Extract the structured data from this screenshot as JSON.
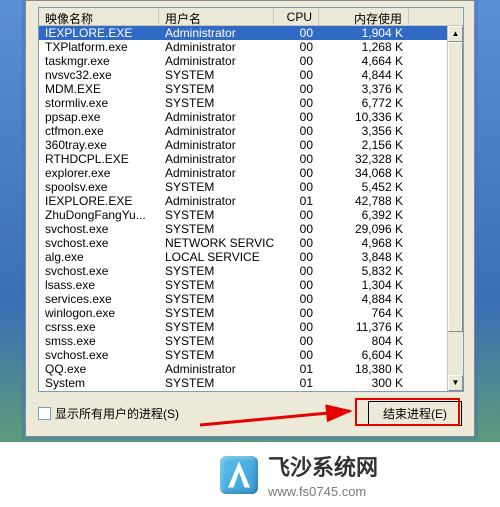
{
  "columns": {
    "image": "映像名称",
    "user": "用户名",
    "cpu": "CPU",
    "memory": "内存使用"
  },
  "rows": [
    {
      "img": "IEXPLORE.EXE",
      "user": "Administrator",
      "cpu": "00",
      "mem": "1,904 K",
      "sel": true
    },
    {
      "img": "TXPlatform.exe",
      "user": "Administrator",
      "cpu": "00",
      "mem": "1,268 K"
    },
    {
      "img": "taskmgr.exe",
      "user": "Administrator",
      "cpu": "00",
      "mem": "4,664 K"
    },
    {
      "img": "nvsvc32.exe",
      "user": "SYSTEM",
      "cpu": "00",
      "mem": "4,844 K"
    },
    {
      "img": "MDM.EXE",
      "user": "SYSTEM",
      "cpu": "00",
      "mem": "3,376 K"
    },
    {
      "img": "stormliv.exe",
      "user": "SYSTEM",
      "cpu": "00",
      "mem": "6,772 K"
    },
    {
      "img": "ppsap.exe",
      "user": "Administrator",
      "cpu": "00",
      "mem": "10,336 K"
    },
    {
      "img": "ctfmon.exe",
      "user": "Administrator",
      "cpu": "00",
      "mem": "3,356 K"
    },
    {
      "img": "360tray.exe",
      "user": "Administrator",
      "cpu": "00",
      "mem": "2,156 K"
    },
    {
      "img": "RTHDCPL.EXE",
      "user": "Administrator",
      "cpu": "00",
      "mem": "32,328 K"
    },
    {
      "img": "explorer.exe",
      "user": "Administrator",
      "cpu": "00",
      "mem": "34,068 K"
    },
    {
      "img": "spoolsv.exe",
      "user": "SYSTEM",
      "cpu": "00",
      "mem": "5,452 K"
    },
    {
      "img": "IEXPLORE.EXE",
      "user": "Administrator",
      "cpu": "01",
      "mem": "42,788 K"
    },
    {
      "img": "ZhuDongFangYu...",
      "user": "SYSTEM",
      "cpu": "00",
      "mem": "6,392 K"
    },
    {
      "img": "svchost.exe",
      "user": "SYSTEM",
      "cpu": "00",
      "mem": "29,096 K"
    },
    {
      "img": "svchost.exe",
      "user": "NETWORK SERVICE",
      "cpu": "00",
      "mem": "4,968 K"
    },
    {
      "img": "alg.exe",
      "user": "LOCAL SERVICE",
      "cpu": "00",
      "mem": "3,848 K"
    },
    {
      "img": "svchost.exe",
      "user": "SYSTEM",
      "cpu": "00",
      "mem": "5,832 K"
    },
    {
      "img": "lsass.exe",
      "user": "SYSTEM",
      "cpu": "00",
      "mem": "1,304 K"
    },
    {
      "img": "services.exe",
      "user": "SYSTEM",
      "cpu": "00",
      "mem": "4,884 K"
    },
    {
      "img": "winlogon.exe",
      "user": "SYSTEM",
      "cpu": "00",
      "mem": "764 K"
    },
    {
      "img": "csrss.exe",
      "user": "SYSTEM",
      "cpu": "00",
      "mem": "11,376 K"
    },
    {
      "img": "smss.exe",
      "user": "SYSTEM",
      "cpu": "00",
      "mem": "804 K"
    },
    {
      "img": "svchost.exe",
      "user": "SYSTEM",
      "cpu": "00",
      "mem": "6,604 K"
    },
    {
      "img": "QQ.exe",
      "user": "Administrator",
      "cpu": "01",
      "mem": "18,380 K"
    },
    {
      "img": "System",
      "user": "SYSTEM",
      "cpu": "01",
      "mem": "300 K"
    }
  ],
  "checkbox_label": "显示所有用户的进程(S)",
  "end_button": "结束进程(E)",
  "brand": {
    "name": "飞沙系统网",
    "url": "www.fs0745.com"
  }
}
